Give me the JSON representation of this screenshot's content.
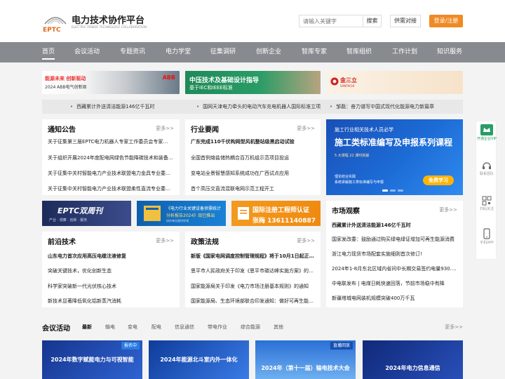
{
  "header": {
    "logo_abbr": "EPTC",
    "site_title": "电力技术协作平台",
    "site_subtitle": "ELECTRIC POWER TECHNOLOGY COLLABORATION",
    "search_placeholder": "请输入关键字",
    "search_label": "搜索",
    "supply_label": "供需对接",
    "login_label": "登录/注册"
  },
  "nav": {
    "items": [
      "首页",
      "会议活动",
      "专题资讯",
      "电力学堂",
      "征集调研",
      "创新企业",
      "智库专家",
      "智库组织",
      "工作计划",
      "知识服务"
    ]
  },
  "banners": {
    "abb": {
      "title": "能源未来 创新驱动",
      "subtitle": "2024 ABB电气创新周",
      "brand": "ABB"
    },
    "standards": {
      "title": "中压技术及基础设计指导",
      "subtitle": "基于IEC和IEEE标准"
    },
    "santachi": {
      "brand": "金三立",
      "sub": "SANTACHI"
    }
  },
  "ticker": [
    "西藏累计外送清洁能源146亿千瓦时",
    "国网天津电力牵头的电动汽车充电机器人国际标准立项",
    "邹磊：奋力谱写中国式现代化能源电力新篇章"
  ],
  "notice": {
    "title": "通知公告",
    "more": "更多>>",
    "items": [
      "关于征集第三届EPTC电力机器人专家工作委员会专家…",
      "关于组织开展2024年度配电网绿色节能降碳技术和装备…",
      "关于征集中关村智能电力产业技术联盟电力金具专业委…",
      "关于征集中关村智能电力产业技术联盟柔性直流专业委…"
    ]
  },
  "industry": {
    "title": "行业要闻",
    "more": "更多>>",
    "items": [
      "广东完成110千伏构网型风机整站级黑启动试验",
      "全国首例熔盐储热耦合百万机组示范项目投运",
      "变电站全景智慧感知系统成功在广西试点应用",
      "首个高压交直流混联电网示范工程开工"
    ]
  },
  "promo": {
    "line1": "施工行业相关技术人员必学",
    "line2": "施工类标准编写及申报系列课程",
    "line3": "5 大课程  22 课时拆解",
    "line4": "理论结合实践",
    "line5": "系统讲解施工类标准编写与申报",
    "button": "免费学习"
  },
  "mid_banners": {
    "weekly": {
      "title": "EPTC双周刊",
      "sub": "产业 · 观察 · 创新 · 服务"
    },
    "report": {
      "title": "《电力行业关键设备供需统计",
      "sub": "分析报告2024》现已推出",
      "note": "协作单位限时申领"
    },
    "cert": {
      "title": "国际注册工程师认证",
      "phone": "张梅 13611140887"
    }
  },
  "market": {
    "title": "市场观察",
    "more": "更多>>",
    "items": [
      "西藏累计外送清洁能源146亿千瓦时",
      "国家发改委：鼓励通过购买绿电绿证增加可再生能源消费",
      "浙江电力现货市场配套实施细则首次修订!",
      "2024年1-8月东北区域内省间中长期交易签约电量930.0…",
      "中电联发布 | 电煤日耗快速回落，节前市场稳中有降",
      "新疆塔城电网装机规模突破400万千瓦"
    ]
  },
  "frontier": {
    "title": "前沿技术",
    "more": "更多>>",
    "items": [
      "山东电力首次应用高压电缆注液修复",
      "突破关键技术，优化创新生态",
      "科学家突破新一代光伏核心技术",
      "新技术显著降低氧化铝新蒸汽消耗"
    ]
  },
  "policy": {
    "title": "政策法规",
    "more": "更多>>",
    "items": [
      "新版《国家电网调度控制管理规程》将于10月1日起正…",
      "思平市人民政府关于印发《思平市碳达峰实施方案》的…",
      "国家能源局关于印发《电力市场注册基本规则》的通知",
      "国家能源局、生态环境部联合印发通知：做好可再生能…"
    ]
  },
  "events": {
    "title": "会议活动",
    "tabs": [
      "最新",
      "输电",
      "变电",
      "配电",
      "信息通信",
      "带电作业",
      "综合能源",
      "其他"
    ],
    "more": "更多>>",
    "cards": [
      {
        "title": "2024年数字赋能电力与可视智能",
        "tag": "报名中"
      },
      {
        "title": "2024年能源北斗室内外一体化",
        "tag": ""
      },
      {
        "title": "2024年（第十一届）输电技术大会",
        "tag": "直播回放"
      },
      {
        "title": "2024年电力信息通信",
        "tag": ""
      }
    ]
  },
  "sidebar": {
    "items": [
      "开通企业VIP",
      "联系团队",
      "扫码关注",
      "手机APP"
    ]
  },
  "colors": {
    "accent_orange": "#f08a24",
    "nav_gray": "#878b8f",
    "promo_blue": "#1d6cd6"
  }
}
